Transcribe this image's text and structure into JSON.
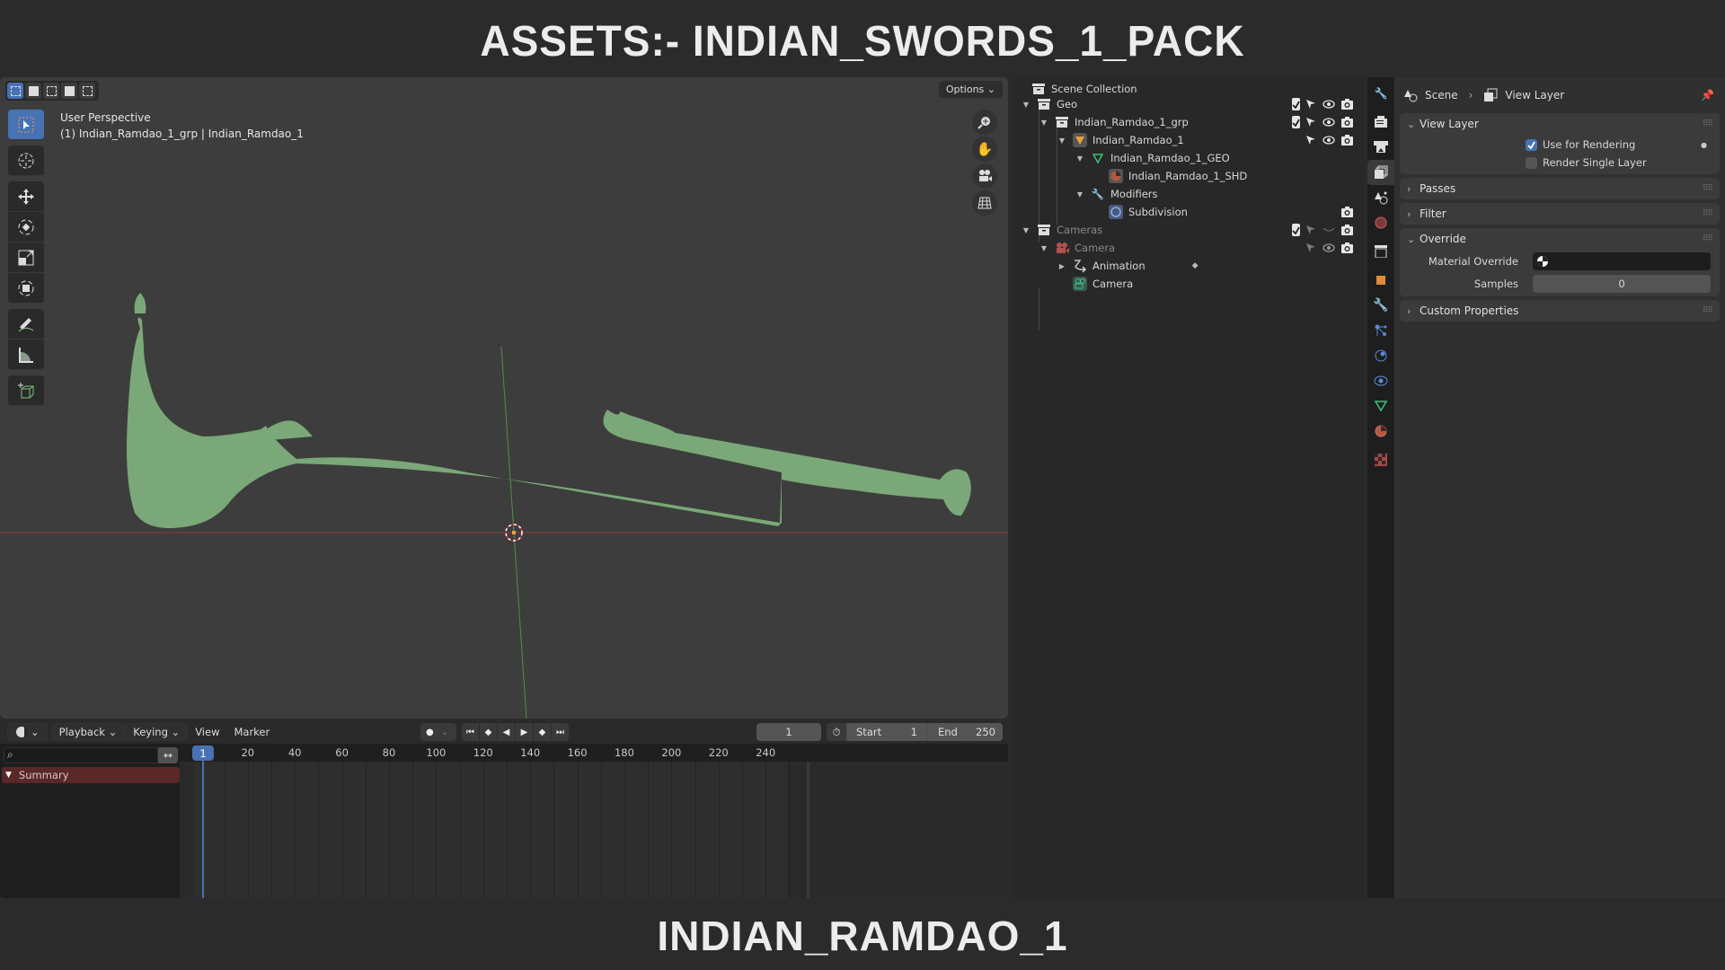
{
  "header_title": "ASSETS:- INDIAN_SWORDS_1_PACK",
  "footer_title": "INDIAN_RAMDAO_1",
  "viewport": {
    "view_name": "User Perspective",
    "selection_info": "(1) Indian_Ramdao_1_grp | Indian_Ramdao_1",
    "options_label": "Options",
    "select_modes": [
      "select-new-icon",
      "select-extend-icon",
      "select-subtract-icon",
      "select-invert-icon",
      "select-intersect-icon"
    ],
    "tools": [
      "select-box-icon",
      "cursor-icon",
      "move-icon",
      "rotate-icon",
      "scale-icon",
      "transform-icon",
      "annotate-icon",
      "measure-icon",
      "add-cube-icon"
    ],
    "nav_gizmo": [
      "zoom-icon",
      "pan-hand-icon",
      "camera-view-icon",
      "ortho-grid-icon"
    ],
    "object_color": "#7aa878",
    "background_color": "#3d3d3d"
  },
  "outliner": {
    "root": "Scene Collection",
    "items": [
      {
        "label": "Geo",
        "type": "collection",
        "depth": 0,
        "expanded": true,
        "checked": true,
        "selectable": true,
        "visible": true,
        "render": true
      },
      {
        "label": "Indian_Ramdao_1_grp",
        "type": "collection",
        "depth": 1,
        "expanded": true,
        "checked": true,
        "selectable": true,
        "visible": true,
        "render": true
      },
      {
        "label": "Indian_Ramdao_1",
        "type": "object",
        "depth": 2,
        "expanded": true,
        "selectable": true,
        "visible": true,
        "render": true
      },
      {
        "label": "Indian_Ramdao_1_GEO",
        "type": "mesh",
        "depth": 3,
        "expanded": true
      },
      {
        "label": "Indian_Ramdao_1_SHD",
        "type": "material",
        "depth": 4
      },
      {
        "label": "Modifiers",
        "type": "modifiers",
        "depth": 3,
        "expanded": true
      },
      {
        "label": "Subdivision",
        "type": "modifier",
        "depth": 4,
        "render": true
      },
      {
        "label": "Cameras",
        "type": "collection",
        "depth": 0,
        "expanded": true,
        "checked": true,
        "dimmed": true,
        "render": true
      },
      {
        "label": "Camera",
        "type": "camera-object",
        "depth": 1,
        "expanded": true,
        "dimmed": true,
        "visible": true,
        "render": true
      },
      {
        "label": "Animation",
        "type": "animation",
        "depth": 2,
        "expanded": false
      },
      {
        "label": "Camera",
        "type": "camera-data",
        "depth": 2
      }
    ]
  },
  "properties": {
    "breadcrumb": [
      "Scene",
      "View Layer"
    ],
    "tabs": [
      "tool-icon",
      "render-icon",
      "output-icon",
      "view-layer-icon",
      "scene-icon",
      "world-icon",
      "collection-icon",
      "object-icon",
      "modifier-icon",
      "particles-icon",
      "physics-icon",
      "constraints-icon",
      "data-icon",
      "material-icon",
      "texture-icon"
    ],
    "active_tab": "view-layer-icon",
    "panels": {
      "view_layer": {
        "title": "View Layer",
        "use_for_rendering": "Use for Rendering",
        "use_for_rendering_checked": true,
        "render_single_layer": "Render Single Layer",
        "render_single_layer_checked": false
      },
      "passes": "Passes",
      "filter": "Filter",
      "override": {
        "title": "Override",
        "material_override_label": "Material Override",
        "material_override_value": "",
        "samples_label": "Samples",
        "samples_value": "0"
      },
      "custom_properties": "Custom Properties"
    }
  },
  "timeline": {
    "editor_icon": "timeline-icon",
    "menus": [
      "Playback",
      "Keying",
      "View",
      "Marker"
    ],
    "current_frame": "1",
    "start_label": "Start",
    "start_value": "1",
    "end_label": "End",
    "end_value": "250",
    "ruler_ticks": [
      "20",
      "40",
      "60",
      "80",
      "100",
      "120",
      "140",
      "160",
      "180",
      "200",
      "220",
      "240"
    ],
    "summary_label": "Summary",
    "search_placeholder": ""
  }
}
